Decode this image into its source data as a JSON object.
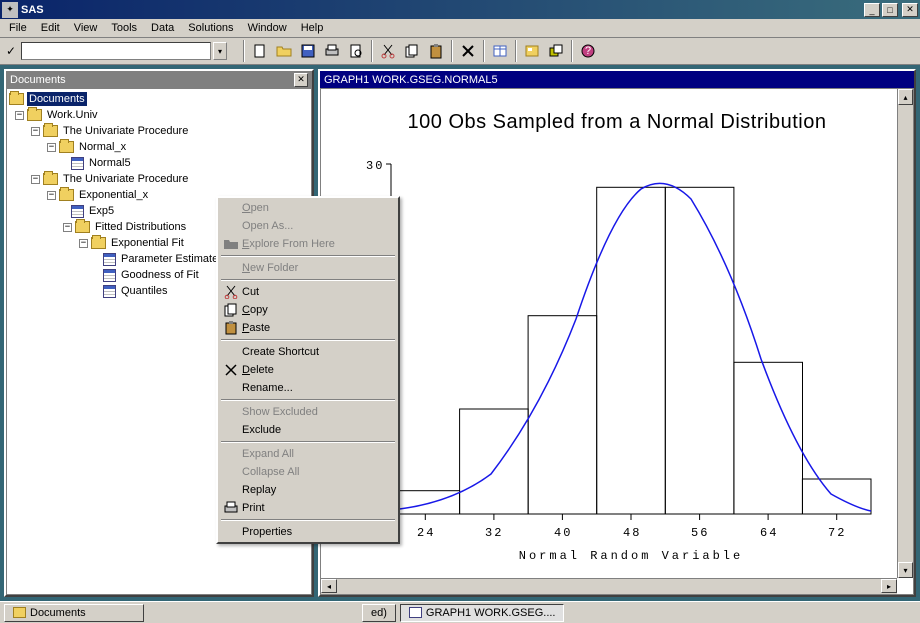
{
  "app_title": "SAS",
  "menubar": [
    "File",
    "Edit",
    "View",
    "Tools",
    "Data",
    "Solutions",
    "Window",
    "Help"
  ],
  "command_value": "",
  "panels": {
    "documents": {
      "title": "Documents",
      "tree": {
        "root": "Documents",
        "n1": "Work.Univ",
        "n2": "The Univariate Procedure",
        "n3": "Normal_x",
        "n4": "Normal5",
        "n5": "The Univariate Procedure",
        "n6": "Exponential_x",
        "n7": "Exp5",
        "n8": "Fitted Distributions",
        "n9": "Exponential Fit",
        "n10": "Parameter Estimates",
        "n11": "Goodness of Fit",
        "n12": "Quantiles"
      }
    },
    "graph": {
      "title": "GRAPH1  WORK.GSEG.NORMAL5"
    }
  },
  "context_menu": [
    {
      "label": "Open",
      "u": "O",
      "disabled": true
    },
    {
      "label": "Open As...",
      "u": "",
      "disabled": true
    },
    {
      "label": "Explore From Here",
      "u": "E",
      "disabled": true,
      "icon": "folder"
    },
    {
      "sep": true
    },
    {
      "label": "New Folder",
      "u": "N",
      "disabled": true
    },
    {
      "sep": true
    },
    {
      "label": "Cut",
      "u": "",
      "disabled": false,
      "icon": "cut"
    },
    {
      "label": "Copy",
      "u": "C",
      "disabled": false,
      "icon": "copy"
    },
    {
      "label": "Paste",
      "u": "P",
      "disabled": false,
      "icon": "paste"
    },
    {
      "sep": true
    },
    {
      "label": "Create Shortcut",
      "u": "",
      "disabled": false
    },
    {
      "label": "Delete",
      "u": "D",
      "disabled": false,
      "icon": "delete"
    },
    {
      "label": "Rename...",
      "u": "",
      "disabled": false
    },
    {
      "sep": true
    },
    {
      "label": "Show Excluded",
      "u": "",
      "disabled": true
    },
    {
      "label": "Exclude",
      "u": "",
      "disabled": false
    },
    {
      "sep": true
    },
    {
      "label": "Expand All",
      "u": "",
      "disabled": true
    },
    {
      "label": "Collapse All",
      "u": "",
      "disabled": true
    },
    {
      "label": "Replay",
      "u": "",
      "disabled": false
    },
    {
      "label": "Print",
      "u": "",
      "disabled": false,
      "icon": "print"
    },
    {
      "sep": true
    },
    {
      "label": "Properties",
      "u": "",
      "disabled": false
    }
  ],
  "taskbar": [
    {
      "label": "Documents",
      "active": false,
      "hidden": false
    },
    {
      "label": "ed)",
      "active": false,
      "partial": true
    },
    {
      "label": "GRAPH1  WORK.GSEG....",
      "active": true,
      "icon": "g"
    }
  ],
  "chart_data": {
    "type": "bar+curve",
    "title": "100 Obs Sampled from a Normal Distribution",
    "xlabel": "Normal Random Variable",
    "ylabel": "",
    "ylim": [
      0,
      30
    ],
    "yticks": [
      30
    ],
    "x_categories": [
      24,
      32,
      40,
      48,
      56,
      64,
      72
    ],
    "bars": [
      {
        "x": 24,
        "count": 2
      },
      {
        "x": 32,
        "count": 9
      },
      {
        "x": 40,
        "count": 17
      },
      {
        "x": 48,
        "count": 28
      },
      {
        "x": 56,
        "count": 28
      },
      {
        "x": 64,
        "count": 13
      },
      {
        "x": 72,
        "count": 3
      }
    ],
    "curve_note": "normal density overlaid, peak near x=50"
  }
}
